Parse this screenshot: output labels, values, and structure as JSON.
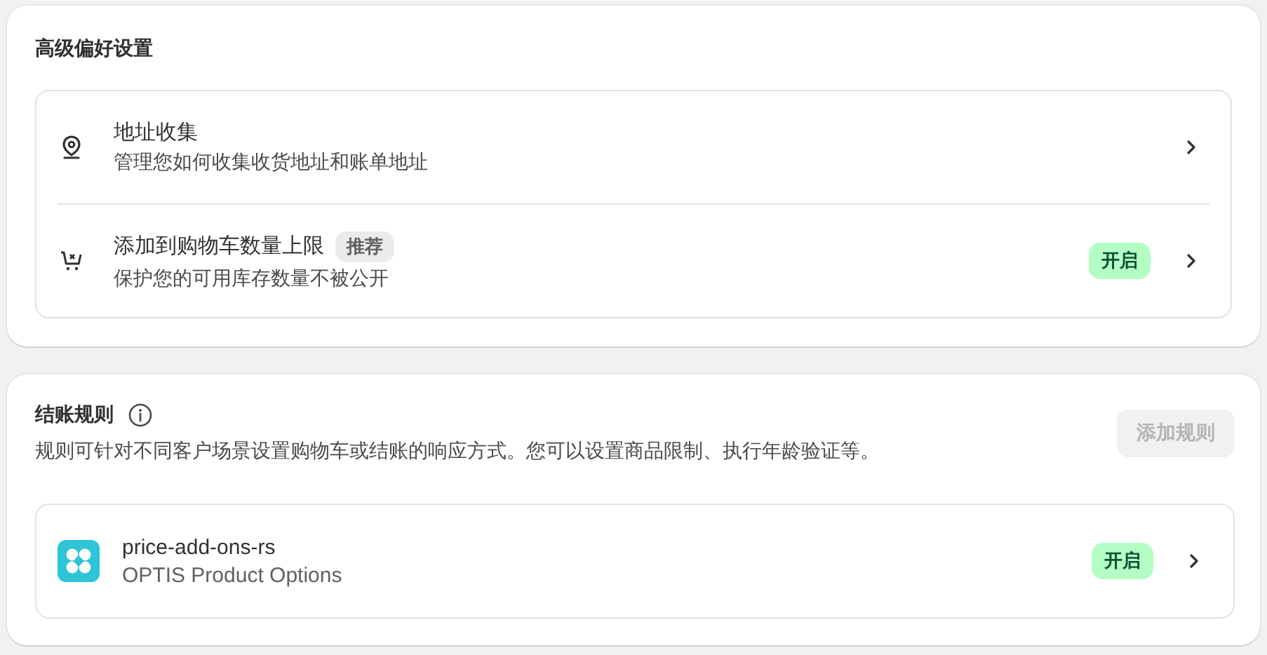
{
  "preferences": {
    "title": "高级偏好设置",
    "items": [
      {
        "kind": "address",
        "title": "地址收集",
        "subtitle": "管理您如何收集收货地址和账单地址"
      },
      {
        "kind": "cart_limit",
        "title": "添加到购物车数量上限",
        "tag": "推荐",
        "subtitle": "保护您的可用库存数量不被公开",
        "status": {
          "label": "开启",
          "on": true
        }
      }
    ]
  },
  "checkout_rules": {
    "title": "结账规则",
    "description": "规则可针对不同客户场景设置购物车或结账的响应方式。您可以设置商品限制、执行年龄验证等。",
    "add_button": {
      "label": "添加规则",
      "disabled": true
    },
    "items": [
      {
        "kind": "app",
        "title": "price-add-ons-rs",
        "subtitle": "OPTIS Product Options",
        "status": {
          "label": "开启",
          "on": true
        }
      }
    ]
  }
}
